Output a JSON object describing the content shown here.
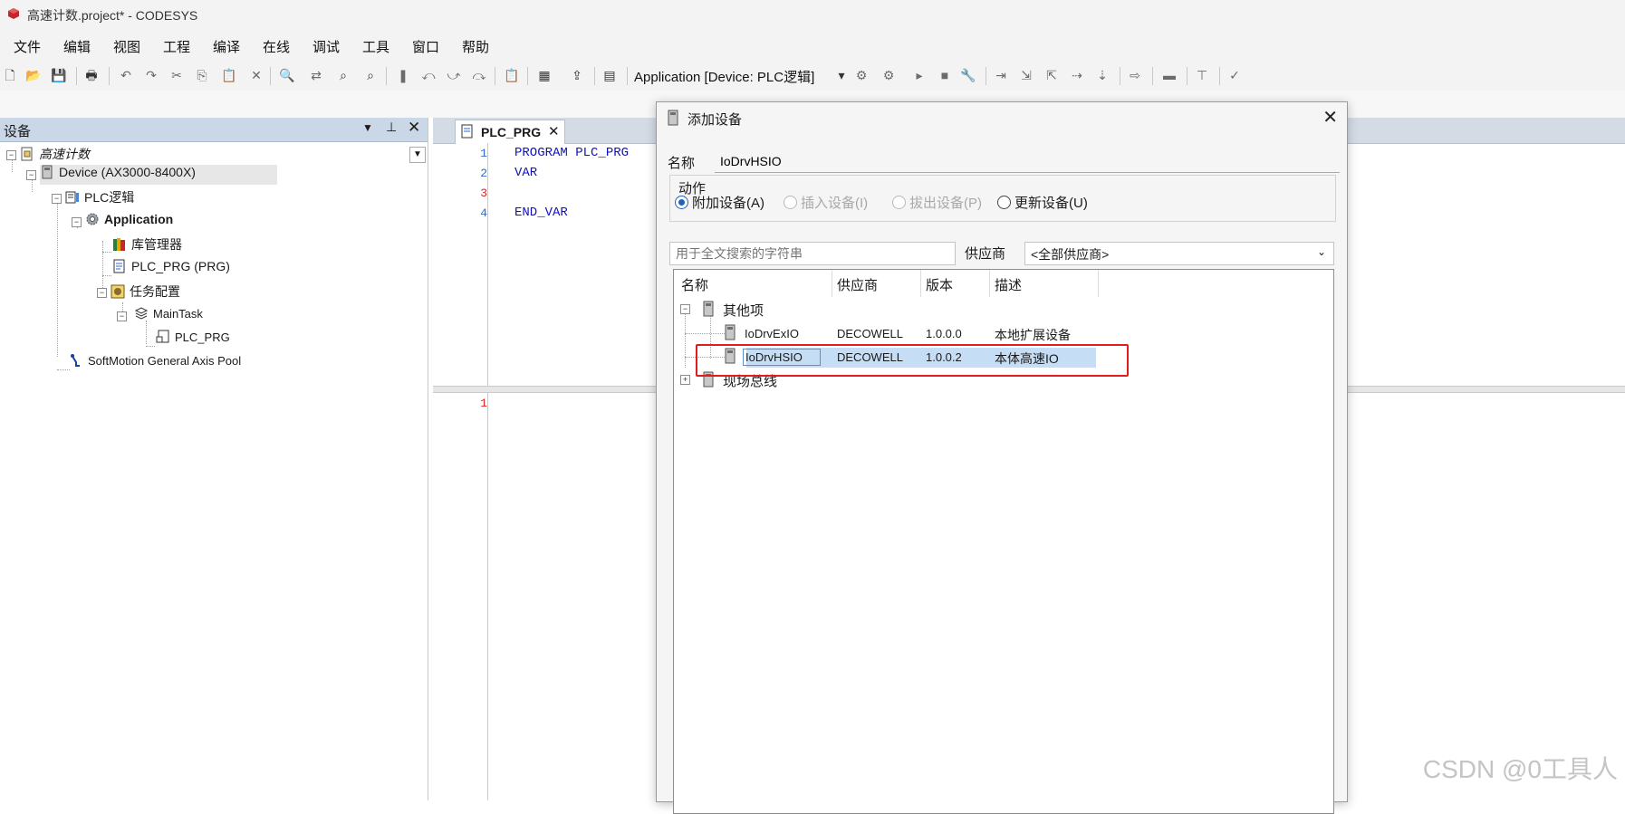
{
  "window": {
    "title": "高速计数.project* - CODESYS"
  },
  "menu": [
    "文件",
    "编辑",
    "视图",
    "工程",
    "编译",
    "在线",
    "调试",
    "工具",
    "窗口",
    "帮助"
  ],
  "toolbar": {
    "app_selector": "Application [Device: PLC逻辑]"
  },
  "device_panel": {
    "title": "设备",
    "tree": [
      {
        "label": "高速计数",
        "icon": "project-icon"
      },
      {
        "label": "Device (AX3000-8400X)",
        "icon": "device-icon"
      },
      {
        "label": "PLC逻辑",
        "icon": "plc-logic-icon"
      },
      {
        "label": "Application",
        "icon": "gear-icon"
      },
      {
        "label": "库管理器",
        "icon": "library-icon"
      },
      {
        "label": "PLC_PRG (PRG)",
        "icon": "program-icon"
      },
      {
        "label": "任务配置",
        "icon": "task-config-icon"
      },
      {
        "label": "MainTask",
        "icon": "task-icon"
      },
      {
        "label": "PLC_PRG",
        "icon": "program-call-icon"
      },
      {
        "label": "SoftMotion General Axis Pool",
        "icon": "axis-pool-icon"
      }
    ]
  },
  "editor": {
    "tab_label": "PLC_PRG",
    "decl_lines": [
      {
        "num": "1",
        "code": "PROGRAM PLC_PRG"
      },
      {
        "num": "2",
        "code": "VAR"
      },
      {
        "num": "3",
        "code": ""
      },
      {
        "num": "4",
        "code": "END_VAR"
      }
    ],
    "impl_lines": [
      {
        "num": "1"
      }
    ]
  },
  "dialog": {
    "title": "添加设备",
    "name_label": "名称",
    "name_value": "IoDrvHSIO",
    "action_label": "动作",
    "actions": [
      {
        "label": "附加设备(A)",
        "state": "selected"
      },
      {
        "label": "插入设备(I)",
        "state": "disabled"
      },
      {
        "label": "拔出设备(P)",
        "state": "disabled"
      },
      {
        "label": "更新设备(U)",
        "state": "normal"
      }
    ],
    "search_placeholder": "用于全文搜索的字符串",
    "vendor_label": "供应商",
    "vendor_value": "<全部供应商>",
    "columns": [
      "名称",
      "供应商",
      "版本",
      "描述"
    ],
    "groups": [
      {
        "name": "其他项",
        "items": [
          {
            "name": "IoDrvExIO",
            "vendor": "DECOWELL",
            "version": "1.0.0.0",
            "desc": "本地扩展设备"
          },
          {
            "name": "IoDrvHSIO",
            "vendor": "DECOWELL",
            "version": "1.0.0.2",
            "desc": "本体高速IO"
          }
        ]
      },
      {
        "name": "现场总线",
        "items": []
      }
    ],
    "selected_item": "IoDrvHSIO",
    "highlight_color": "#e01c1c"
  },
  "watermark": "CSDN @0工具人"
}
